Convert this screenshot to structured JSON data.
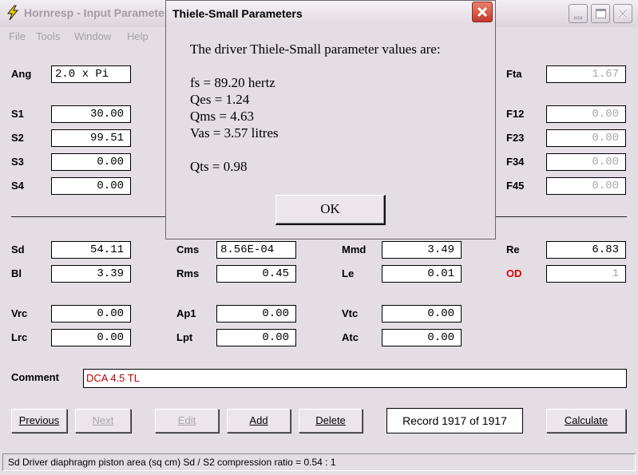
{
  "window": {
    "title": "Hornresp - Input Parameters"
  },
  "menu": [
    "File",
    "Tools",
    "Window",
    "Help"
  ],
  "labels": {
    "ang": "Ang",
    "s1": "S1",
    "s2": "S2",
    "s3": "S3",
    "s4": "S4",
    "fta": "Fta",
    "f12": "F12",
    "f23": "F23",
    "f34": "F34",
    "f45": "F45",
    "sd": "Sd",
    "bl": "Bl",
    "cms": "Cms",
    "rms": "Rms",
    "mmd": "Mmd",
    "le": "Le",
    "re": "Re",
    "od": "OD",
    "vrc": "Vrc",
    "lrc": "Lrc",
    "ap1": "Ap1",
    "lpt": "Lpt",
    "vtc": "Vtc",
    "atc": "Atc",
    "comment": "Comment"
  },
  "values": {
    "ang": "2.0 x Pi",
    "s1": "30.00",
    "s2": "99.51",
    "s3": "0.00",
    "s4": "0.00",
    "fta": "1.67",
    "f12": "0.00",
    "f23": "0.00",
    "f34": "0.00",
    "f45": "0.00",
    "sd": "54.11",
    "bl": "3.39",
    "cms": "8.56E-04",
    "rms": "0.45",
    "mmd": "3.49",
    "le": "0.01",
    "re": "6.83",
    "od": "1",
    "vrc": "0.00",
    "lrc": "0.00",
    "ap1": "0.00",
    "lpt": "0.00",
    "vtc": "0.00",
    "atc": "0.00",
    "comment": "DCA 4.5 TL"
  },
  "buttons": {
    "previous": "Previous",
    "next": "Next",
    "edit": "Edit",
    "add": "Add",
    "delete": "Delete",
    "calculate": "Calculate"
  },
  "record": "Record 1917 of 1917",
  "status": "Sd  Driver diaphragm piston area  (sq cm)  Sd / S2 compression ratio = 0.54 : 1",
  "dialog": {
    "title": "Thiele-Small Parameters",
    "intro": "The driver Thiele-Small parameter values are:",
    "fs": "fs = 89.20 hertz",
    "qes": "Qes = 1.24",
    "qms": "Qms = 4.63",
    "vas": "Vas = 3.57 litres",
    "qts": "Qts = 0.98",
    "ok": "OK"
  },
  "colors": {
    "background": "#e4dde4",
    "od_label": "#e00000",
    "comment_text": "#c00000",
    "disabled_text": "#a9a5a9"
  },
  "icons": [
    "lightning-icon",
    "minimize-icon",
    "maximize-icon",
    "close-icon"
  ]
}
